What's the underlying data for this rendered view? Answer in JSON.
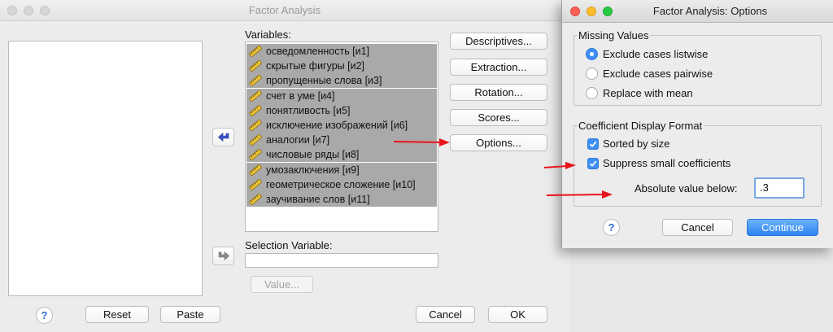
{
  "main_window": {
    "title": "Factor Analysis",
    "variables_label": "Variables:",
    "variables": [
      "осведомленность [и1]",
      "скрытые фигуры [и2]",
      "пропущенные слова [и3]",
      "счет в уме [и4]",
      "понятливость [и5]",
      "исключение изображений [и6]",
      "аналогии [и7]",
      "числовые ряды [и8]",
      "умозаключения [и9]",
      "геометрическое сложение [и10]",
      "заучивание слов [и11]"
    ],
    "selection_variable_label": "Selection Variable:",
    "selection_variable_value": "",
    "value_button": "Value...",
    "side_buttons": {
      "descriptives": "Descriptives...",
      "extraction": "Extraction...",
      "rotation": "Rotation...",
      "scores": "Scores...",
      "options": "Options..."
    },
    "footer": {
      "help": "?",
      "reset": "Reset",
      "paste": "Paste",
      "cancel": "Cancel",
      "ok": "OK"
    }
  },
  "options_window": {
    "title": "Factor Analysis: Options",
    "missing_values": {
      "title": "Missing Values",
      "options": [
        {
          "label": "Exclude cases listwise",
          "selected": true
        },
        {
          "label": "Exclude cases pairwise",
          "selected": false
        },
        {
          "label": "Replace with mean",
          "selected": false
        }
      ]
    },
    "coefficient_format": {
      "title": "Coefficient Display Format",
      "sorted_by_size": {
        "label": "Sorted by size",
        "checked": true
      },
      "suppress_small": {
        "label": "Suppress small coefficients",
        "checked": true
      },
      "absolute_value_label": "Absolute value below:",
      "absolute_value": ".3"
    },
    "footer": {
      "help": "?",
      "cancel": "Cancel",
      "continue": "Continue"
    }
  },
  "colors": {
    "accent": "#3d8ff5",
    "annotation_arrow": "#e8141b",
    "selection_gray": "#a9a9a9"
  }
}
